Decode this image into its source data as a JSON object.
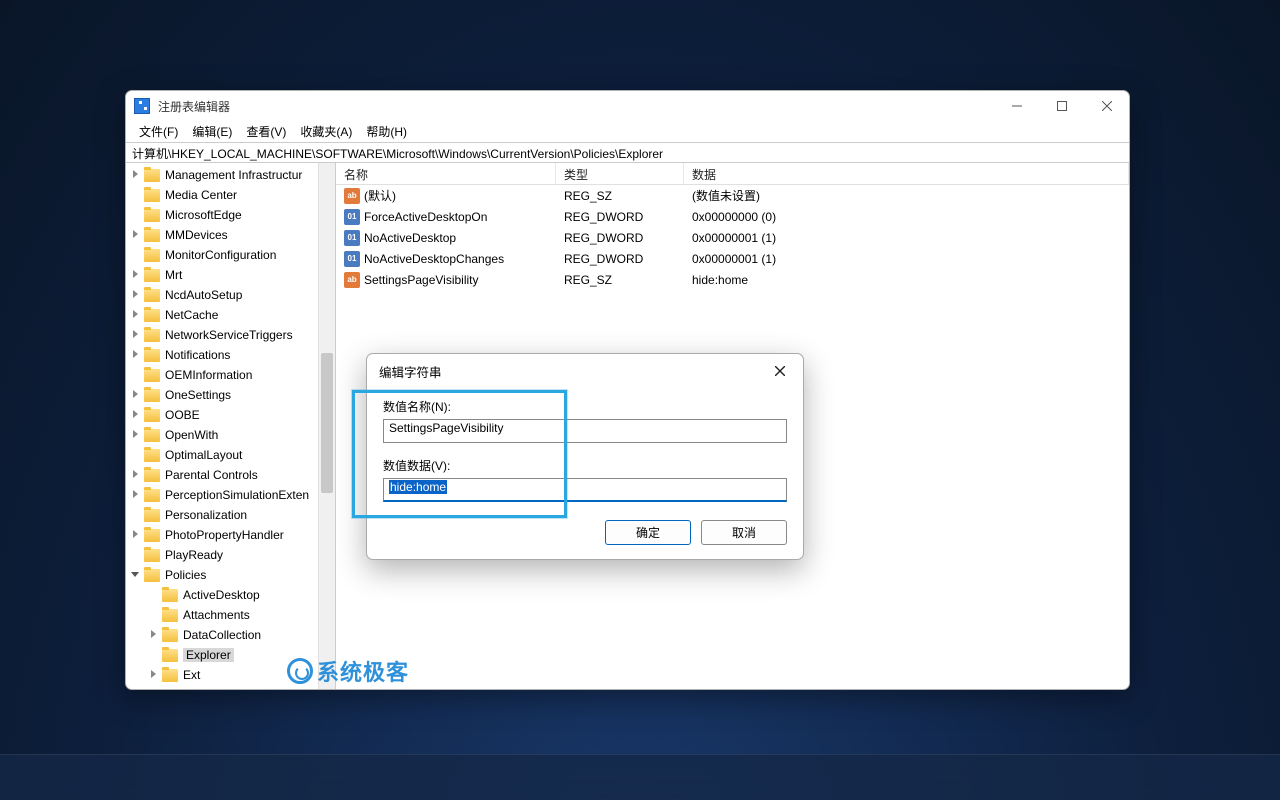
{
  "titlebar": {
    "title": "注册表编辑器"
  },
  "menu": {
    "file": "文件(F)",
    "edit": "编辑(E)",
    "view": "查看(V)",
    "favorites": "收藏夹(A)",
    "help": "帮助(H)"
  },
  "address": "计算机\\HKEY_LOCAL_MACHINE\\SOFTWARE\\Microsoft\\Windows\\CurrentVersion\\Policies\\Explorer",
  "tree": [
    {
      "depth": 1,
      "chev": "r",
      "label": "Management Infrastructur"
    },
    {
      "depth": 1,
      "chev": "",
      "label": "Media Center"
    },
    {
      "depth": 1,
      "chev": "",
      "label": "MicrosoftEdge"
    },
    {
      "depth": 1,
      "chev": "r",
      "label": "MMDevices"
    },
    {
      "depth": 1,
      "chev": "",
      "label": "MonitorConfiguration"
    },
    {
      "depth": 1,
      "chev": "r",
      "label": "Mrt"
    },
    {
      "depth": 1,
      "chev": "r",
      "label": "NcdAutoSetup"
    },
    {
      "depth": 1,
      "chev": "r",
      "label": "NetCache"
    },
    {
      "depth": 1,
      "chev": "r",
      "label": "NetworkServiceTriggers"
    },
    {
      "depth": 1,
      "chev": "r",
      "label": "Notifications"
    },
    {
      "depth": 1,
      "chev": "",
      "label": "OEMInformation"
    },
    {
      "depth": 1,
      "chev": "r",
      "label": "OneSettings"
    },
    {
      "depth": 1,
      "chev": "r",
      "label": "OOBE"
    },
    {
      "depth": 1,
      "chev": "r",
      "label": "OpenWith"
    },
    {
      "depth": 1,
      "chev": "",
      "label": "OptimalLayout"
    },
    {
      "depth": 1,
      "chev": "r",
      "label": "Parental Controls"
    },
    {
      "depth": 1,
      "chev": "r",
      "label": "PerceptionSimulationExten"
    },
    {
      "depth": 1,
      "chev": "",
      "label": "Personalization"
    },
    {
      "depth": 1,
      "chev": "r",
      "label": "PhotoPropertyHandler"
    },
    {
      "depth": 1,
      "chev": "",
      "label": "PlayReady"
    },
    {
      "depth": 1,
      "chev": "d",
      "label": "Policies"
    },
    {
      "depth": 2,
      "chev": "",
      "label": "ActiveDesktop"
    },
    {
      "depth": 2,
      "chev": "",
      "label": "Attachments"
    },
    {
      "depth": 2,
      "chev": "r",
      "label": "DataCollection"
    },
    {
      "depth": 2,
      "chev": "",
      "label": "Explorer",
      "selected": true
    },
    {
      "depth": 2,
      "chev": "r",
      "label": "Ext"
    }
  ],
  "cols": {
    "name": "名称",
    "type": "类型",
    "data": "数据"
  },
  "values": [
    {
      "icon": "sz",
      "name": "(默认)",
      "type": "REG_SZ",
      "data": "(数值未设置)"
    },
    {
      "icon": "dw",
      "name": "ForceActiveDesktopOn",
      "type": "REG_DWORD",
      "data": "0x00000000 (0)"
    },
    {
      "icon": "dw",
      "name": "NoActiveDesktop",
      "type": "REG_DWORD",
      "data": "0x00000001 (1)"
    },
    {
      "icon": "dw",
      "name": "NoActiveDesktopChanges",
      "type": "REG_DWORD",
      "data": "0x00000001 (1)"
    },
    {
      "icon": "sz",
      "name": "SettingsPageVisibility",
      "type": "REG_SZ",
      "data": "hide:home"
    }
  ],
  "dialog": {
    "title": "编辑字符串",
    "name_label": "数值名称(N):",
    "name_value": "SettingsPageVisibility",
    "data_label": "数值数据(V):",
    "data_value": "hide:home",
    "ok": "确定",
    "cancel": "取消"
  },
  "watermark": "系统极客"
}
